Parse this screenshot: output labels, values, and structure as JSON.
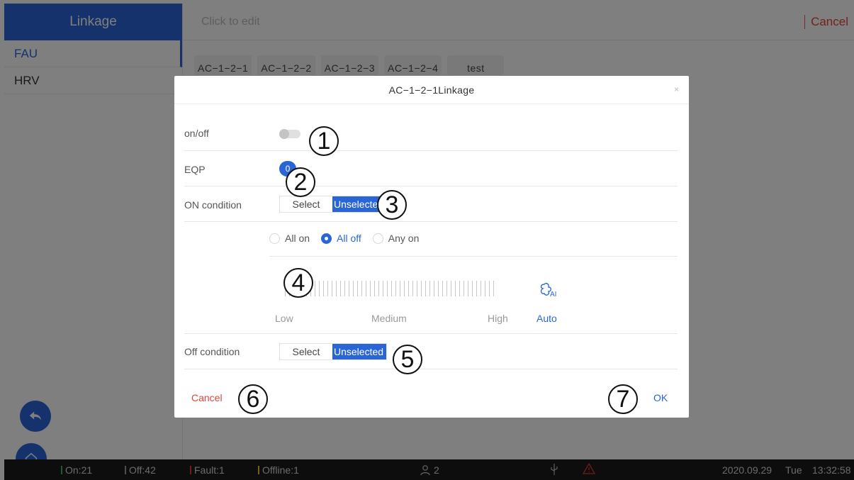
{
  "sidebar": {
    "header": "Linkage",
    "items": [
      {
        "label": "FAU"
      },
      {
        "label": "HRV"
      }
    ]
  },
  "topbar": {
    "edit_placeholder": "Click to edit",
    "cancel_label": "Cancel"
  },
  "chips": [
    "AC−1−2−1",
    "AC−1−2−2",
    "AC−1−2−3",
    "AC−1−2−4",
    "test"
  ],
  "fab": {
    "back_icon": "back-arrow-icon",
    "home_icon": "home-icon"
  },
  "status_bar": {
    "on": "On:21",
    "off": "Off:42",
    "fault": "Fault:1",
    "offline": "Offline:1",
    "users": "2",
    "date": "2020.09.29",
    "weekday": "Tue",
    "time": "13:32:58",
    "colors": {
      "on": "#4caf50",
      "off": "#9e9e9e",
      "fault": "#e53935",
      "offline": "#f5c518"
    }
  },
  "dialog": {
    "title": "AC−1−2−1Linkage",
    "close": "×",
    "onoff_label": "on/off",
    "onoff_enabled": false,
    "eqp_label": "EQP",
    "eqp_count": "0",
    "on_condition": {
      "label": "ON condition",
      "select": "Select",
      "unselected": "Unselected"
    },
    "radios": [
      {
        "label": "All on",
        "checked": false
      },
      {
        "label": "All off",
        "checked": true
      },
      {
        "label": "Any on",
        "checked": false
      }
    ],
    "speed": {
      "low": "Low",
      "medium": "Medium",
      "high": "High",
      "auto": "Auto",
      "auto_icon": "fan-ai-icon",
      "auto_badge": "AI"
    },
    "off_condition": {
      "label": "Off condition",
      "select": "Select",
      "unselected": "Unselected"
    },
    "cancel": "Cancel",
    "ok": "OK"
  },
  "callouts": [
    "1",
    "2",
    "3",
    "4",
    "5",
    "6",
    "7"
  ],
  "colors": {
    "accent": "#2a65d8",
    "danger": "#e0453a"
  }
}
